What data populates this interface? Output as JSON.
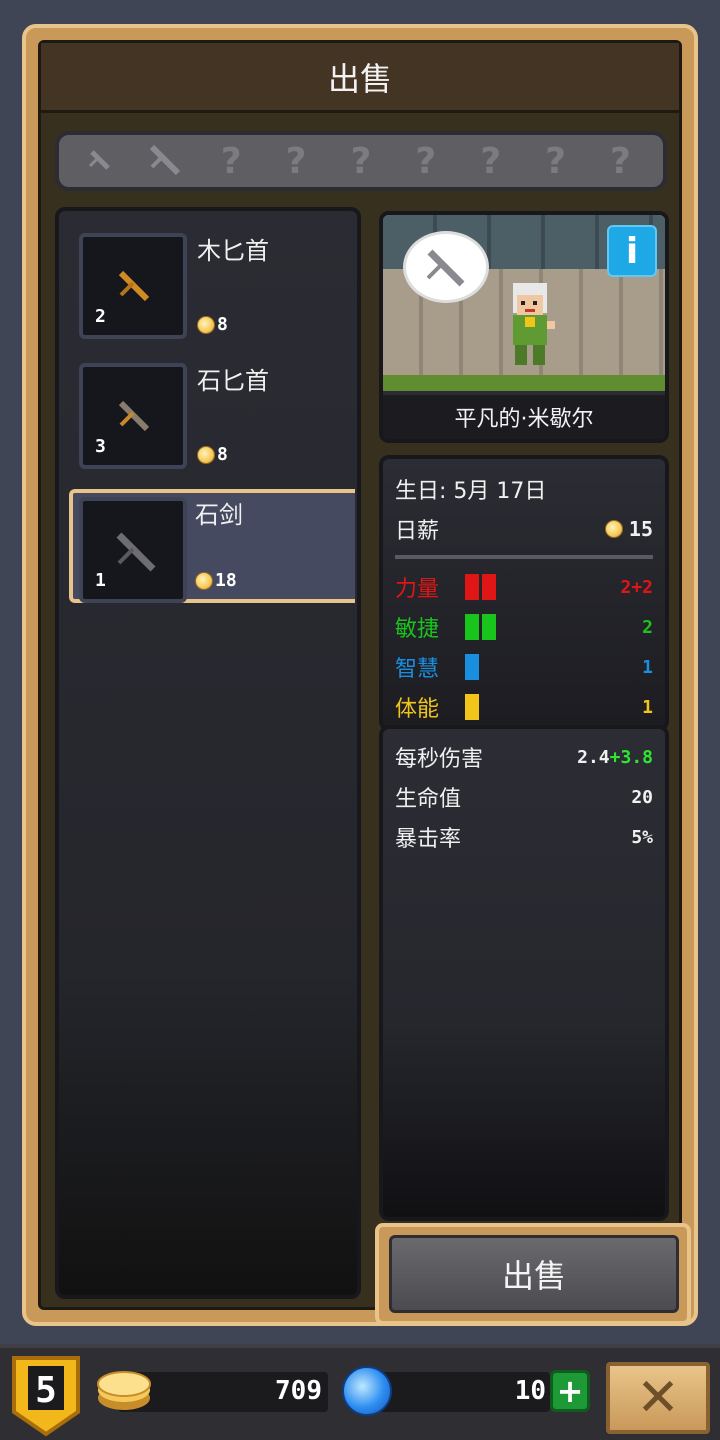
{
  "window": {
    "title": "出售"
  },
  "slots": [
    "dagger",
    "sword",
    "?",
    "?",
    "?",
    "?",
    "?",
    "?",
    "?"
  ],
  "items": [
    {
      "name": "木匕首",
      "qty": "2",
      "price": "8",
      "blade_color": "#d08a24"
    },
    {
      "name": "石匕首",
      "qty": "3",
      "price": "8",
      "blade_color": "#8a7c6a"
    },
    {
      "name": "石剑",
      "qty": "1",
      "price": "18",
      "blade_color": "#6e6e72"
    }
  ],
  "hero": {
    "name": "平凡的·米歇尔",
    "info_label": "i",
    "birthday_label": "生日:",
    "birthday": "5月 17日",
    "salary_label": "日薪",
    "salary": "15"
  },
  "attributes": [
    {
      "label": "力量",
      "value": "2+2",
      "color": "#e01515",
      "bars": 2
    },
    {
      "label": "敏捷",
      "value": "2",
      "color": "#19c41c",
      "bars": 2
    },
    {
      "label": "智慧",
      "value": "1",
      "color": "#1a8fe0",
      "bars": 1
    },
    {
      "label": "体能",
      "value": "1",
      "color": "#f2c51b",
      "bars": 1
    }
  ],
  "combat": {
    "dps_label": "每秒伤害",
    "dps_base": "2.4",
    "dps_bonus": "+3.8",
    "hp_label": "生命值",
    "hp": "20",
    "crit_label": "暴击率",
    "crit": "5%"
  },
  "sell_button": "出售",
  "footer": {
    "level": "5",
    "gold": "709",
    "gems": "10",
    "plus": "+",
    "close": "✕"
  }
}
